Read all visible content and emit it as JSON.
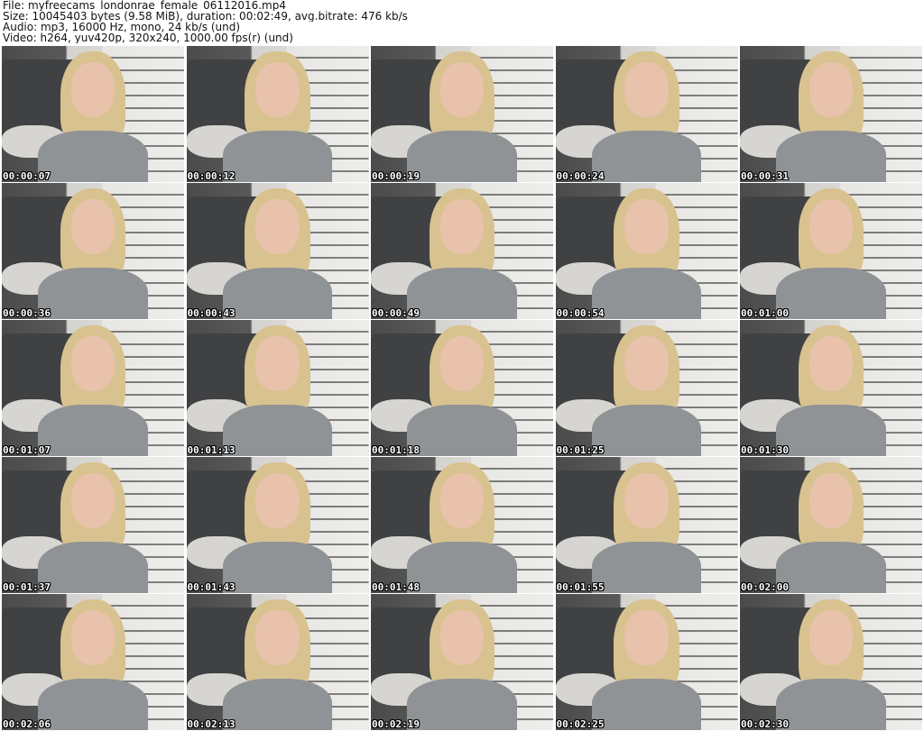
{
  "header": {
    "file_line": "File: myfreecams_londonrae_female_06112016.mp4",
    "size_line": "Size: 10045403 bytes (9.58 MiB), duration: 00:02:49, avg.bitrate: 476 kb/s",
    "audio_line": "Audio: mp3, 16000 Hz, mono, 24 kb/s (und)",
    "video_line": "Video: h264, yuv420p, 320x240, 1000.00 fps(r) (und)"
  },
  "thumbnails": [
    {
      "timestamp": "00:00:07"
    },
    {
      "timestamp": "00:00:12"
    },
    {
      "timestamp": "00:00:19"
    },
    {
      "timestamp": "00:00:24"
    },
    {
      "timestamp": "00:00:31"
    },
    {
      "timestamp": "00:00:36"
    },
    {
      "timestamp": "00:00:43"
    },
    {
      "timestamp": "00:00:49"
    },
    {
      "timestamp": "00:00:54"
    },
    {
      "timestamp": "00:01:00"
    },
    {
      "timestamp": "00:01:07"
    },
    {
      "timestamp": "00:01:13"
    },
    {
      "timestamp": "00:01:18"
    },
    {
      "timestamp": "00:01:25"
    },
    {
      "timestamp": "00:01:30"
    },
    {
      "timestamp": "00:01:37"
    },
    {
      "timestamp": "00:01:43"
    },
    {
      "timestamp": "00:01:48"
    },
    {
      "timestamp": "00:01:55"
    },
    {
      "timestamp": "00:02:00"
    },
    {
      "timestamp": "00:02:06"
    },
    {
      "timestamp": "00:02:13"
    },
    {
      "timestamp": "00:02:19"
    },
    {
      "timestamp": "00:02:25"
    },
    {
      "timestamp": "00:02:30"
    }
  ]
}
